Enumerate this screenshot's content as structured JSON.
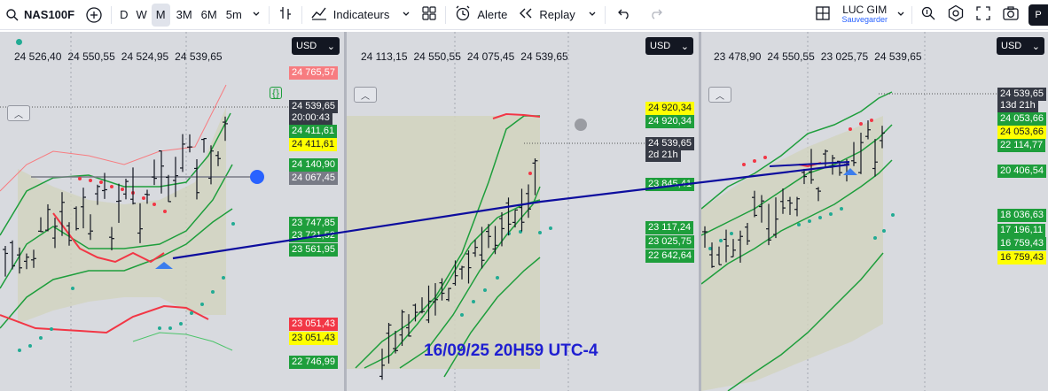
{
  "toolbar": {
    "symbol": "NAS100F",
    "timeframes": [
      "D",
      "W",
      "M",
      "3M",
      "6M",
      "5m"
    ],
    "active_timeframe": "M",
    "indicators_label": "Indicateurs",
    "alert_label": "Alerte",
    "replay_label": "Replay",
    "user_name": "LUC GIM",
    "save_label": "Sauvegarder",
    "publish_label": "P",
    "icons": [
      "search-icon",
      "plus-circle-icon",
      "bar-style-icon",
      "indicators-icon",
      "layout-icon",
      "alarm-clock-icon",
      "replay-icon",
      "undo-icon",
      "redo-icon",
      "grid-icon",
      "zoom-icon",
      "gear-icon",
      "fullscreen-icon",
      "camera-icon"
    ]
  },
  "panels": [
    {
      "ohlc": [
        "24 526,40",
        "24 550,55",
        "24 524,95",
        "24 539,65"
      ],
      "currency": "USD",
      "labels": [
        {
          "text": "24 765,57",
          "style": "pink"
        },
        {
          "text": "24 539,65",
          "style": "dark"
        },
        {
          "text": "20:00:43",
          "style": "dark"
        },
        {
          "text": "24 411,61",
          "style": "green"
        },
        {
          "text": "24 411,61",
          "style": "yellow"
        },
        {
          "text": "24 140,90",
          "style": "green"
        },
        {
          "text": "24 067,45",
          "style": "grey"
        },
        {
          "text": "23 747,85",
          "style": "green"
        },
        {
          "text": "23 721,52",
          "style": "green"
        },
        {
          "text": "23 561,95",
          "style": "green"
        },
        {
          "text": "23 051,43",
          "style": "red"
        },
        {
          "text": "23 051,43",
          "style": "yellow"
        },
        {
          "text": "22 746,99",
          "style": "green"
        }
      ]
    },
    {
      "ohlc": [
        "24 113,15",
        "24 550,55",
        "24 075,45",
        "24 539,65"
      ],
      "currency": "USD",
      "labels": [
        {
          "text": "24 920,34",
          "style": "yellow"
        },
        {
          "text": "24 920,34",
          "style": "green"
        },
        {
          "text": "24 539,65",
          "style": "dark"
        },
        {
          "text": "2d 21h",
          "style": "dark"
        },
        {
          "text": "23 845,41",
          "style": "green"
        },
        {
          "text": "23 117,24",
          "style": "green"
        },
        {
          "text": "23 025,75",
          "style": "green"
        },
        {
          "text": "22 642,64",
          "style": "green"
        }
      ]
    },
    {
      "ohlc": [
        "23 478,90",
        "24 550,55",
        "23 025,75",
        "24 539,65"
      ],
      "currency": "USD",
      "labels": [
        {
          "text": "24 539,65",
          "style": "dark"
        },
        {
          "text": "13d 21h",
          "style": "dark"
        },
        {
          "text": "24 053,66",
          "style": "green"
        },
        {
          "text": "24 053,66",
          "style": "yellow"
        },
        {
          "text": "22 114,77",
          "style": "green"
        },
        {
          "text": "20 406,54",
          "style": "green"
        },
        {
          "text": "18 036,63",
          "style": "green"
        },
        {
          "text": "17 196,11",
          "style": "green"
        },
        {
          "text": "16 759,43",
          "style": "green"
        },
        {
          "text": "16 759,43",
          "style": "yellow"
        }
      ]
    }
  ],
  "annotation": "16/09/25 20H59 UTC-4",
  "colors": {
    "band": "#1e9e3c",
    "resistance": "#f23645",
    "trendline": "#0d0d9e",
    "candle": "#131722"
  }
}
